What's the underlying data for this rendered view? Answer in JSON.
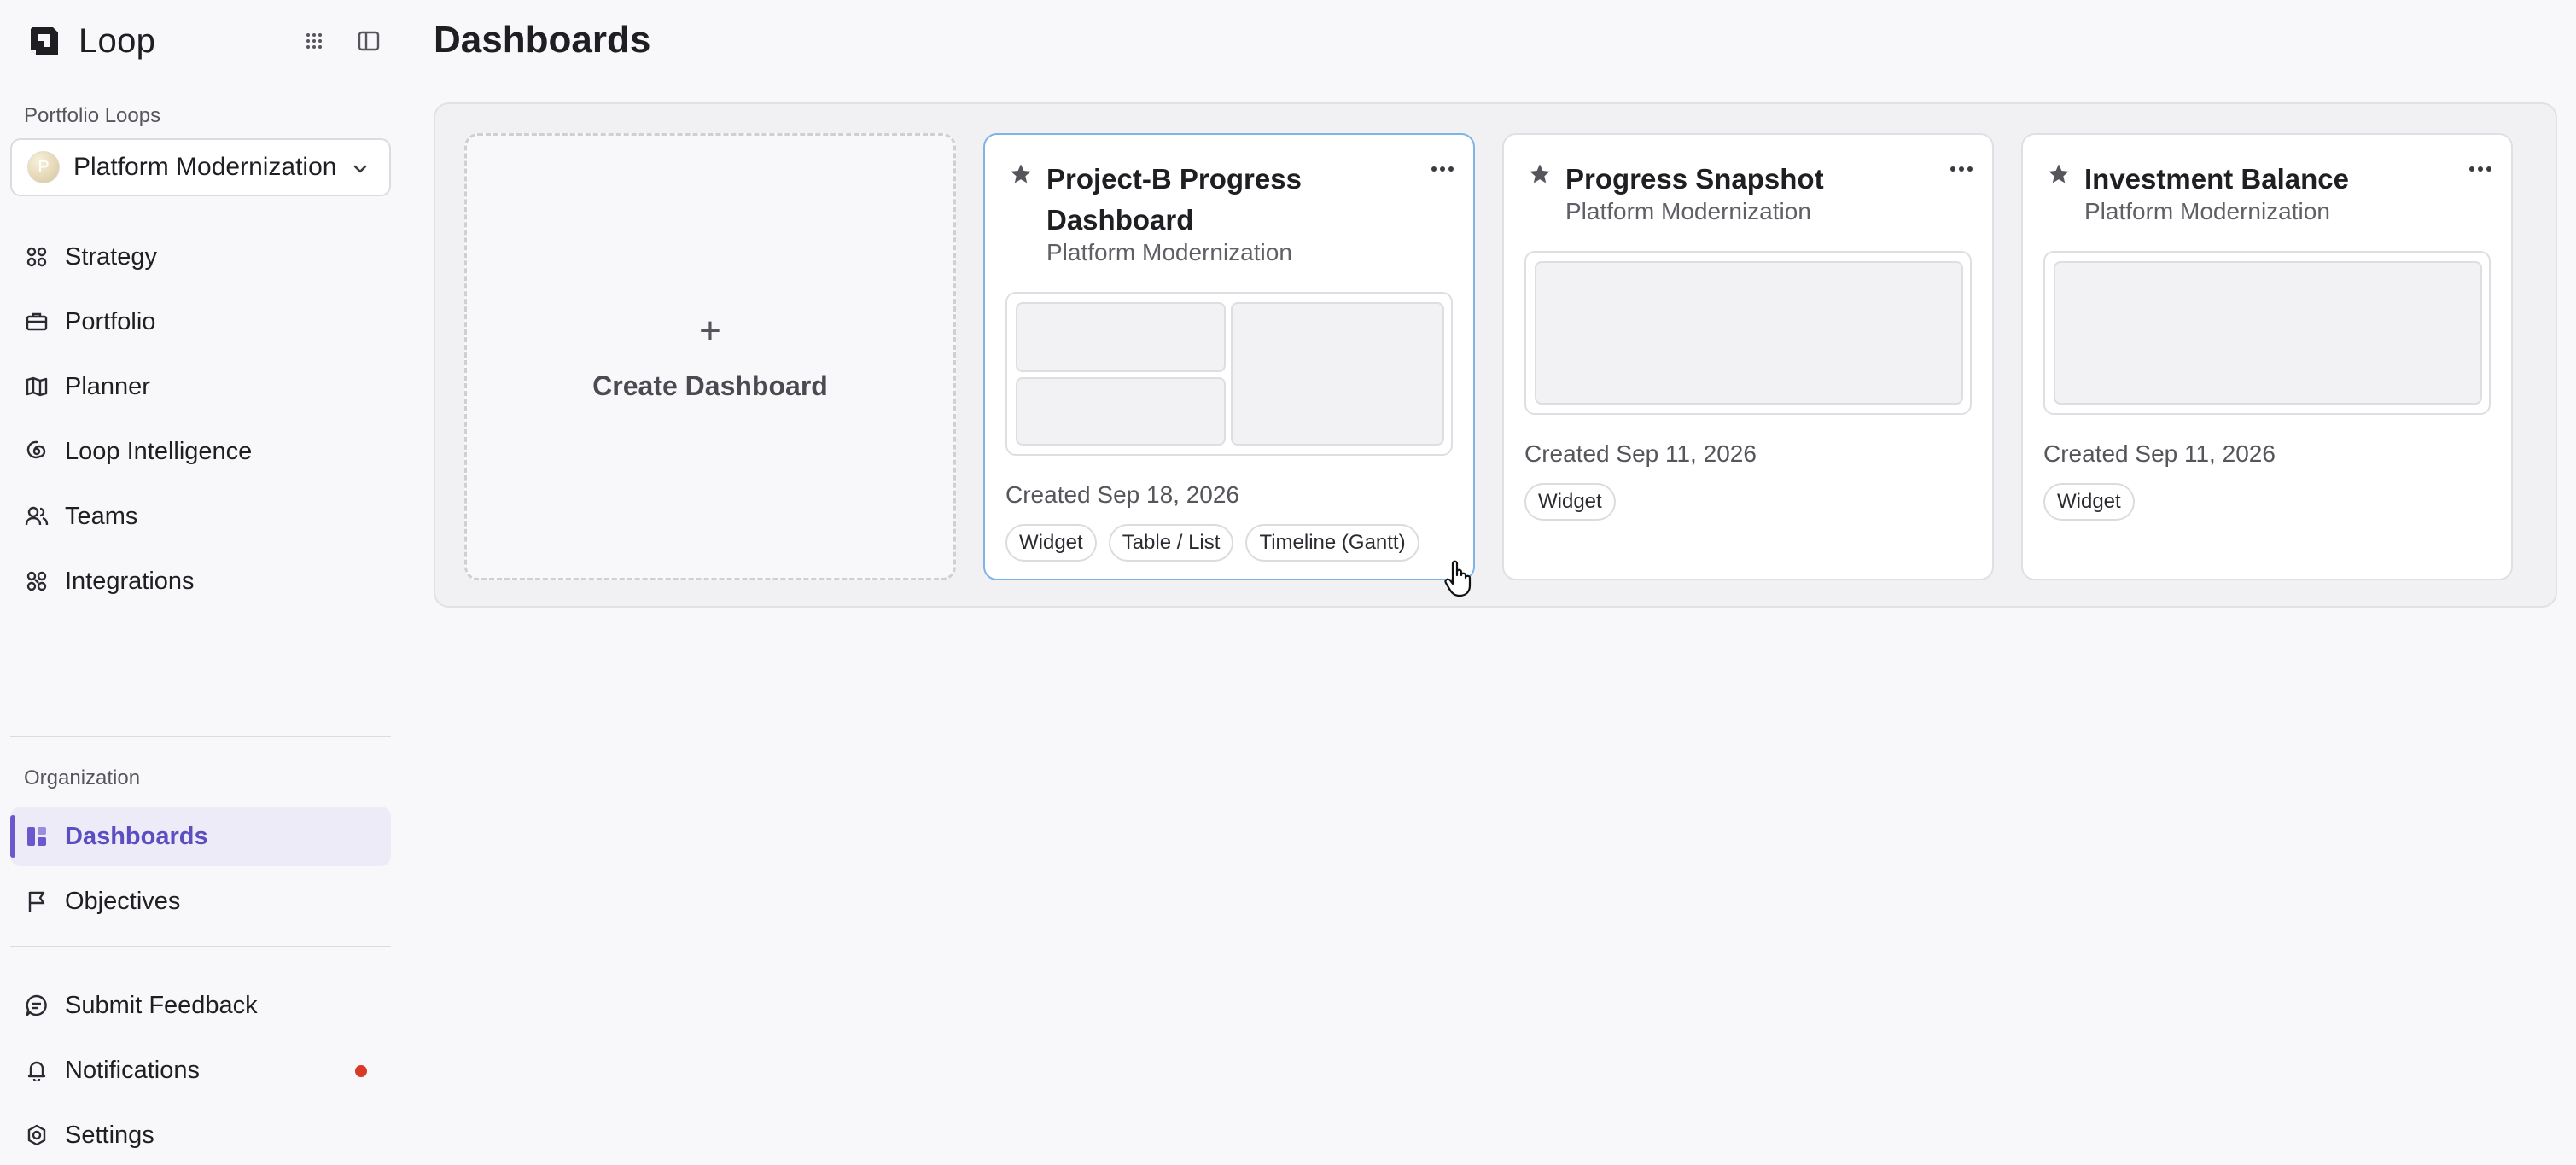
{
  "app": {
    "name": "Loop"
  },
  "sidebar": {
    "portfolio_section_label": "Portfolio Loops",
    "selector": {
      "avatar_letter": "P",
      "value": "Platform Modernization"
    },
    "nav": [
      {
        "label": "Strategy",
        "icon": "strategy-icon"
      },
      {
        "label": "Portfolio",
        "icon": "briefcase-icon"
      },
      {
        "label": "Planner",
        "icon": "map-icon"
      },
      {
        "label": "Loop Intelligence",
        "icon": "spiral-icon"
      },
      {
        "label": "Teams",
        "icon": "users-icon"
      },
      {
        "label": "Integrations",
        "icon": "integrations-icon"
      }
    ],
    "org_section_label": "Organization",
    "org_nav": [
      {
        "label": "Dashboards",
        "icon": "dashboard-icon",
        "active": true
      },
      {
        "label": "Objectives",
        "icon": "flag-icon"
      }
    ],
    "footer_nav": [
      {
        "label": "Submit Feedback",
        "icon": "feedback-icon"
      },
      {
        "label": "Notifications",
        "icon": "bell-icon",
        "has_unread": true
      },
      {
        "label": "Settings",
        "icon": "gear-icon"
      }
    ]
  },
  "main": {
    "title": "Dashboards",
    "create_label": "Create Dashboard",
    "create_plus": "+",
    "dashboards": [
      {
        "title": "Project-B Progress Dashboard",
        "subtitle": "Platform Modernization",
        "created": "Created Sep 18, 2026",
        "tags": [
          "Widget",
          "Table / List",
          "Timeline (Gantt)"
        ]
      },
      {
        "title": "Progress Snapshot",
        "subtitle": "Platform Modernization",
        "created": "Created Sep 11, 2026",
        "tags": [
          "Widget"
        ]
      },
      {
        "title": "Investment Balance",
        "subtitle": "Platform Modernization",
        "created": "Created Sep 11, 2026",
        "tags": [
          "Widget"
        ]
      }
    ]
  },
  "colors": {
    "accent": "#6b58cc",
    "active_bg": "#eeebf8",
    "hover_border": "#7fb4e6",
    "notification_dot": "#d93a26"
  }
}
